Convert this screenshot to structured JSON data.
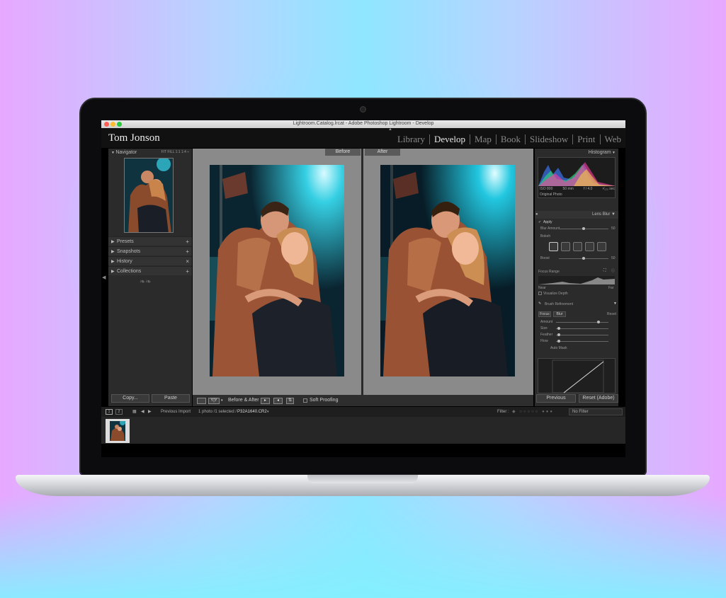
{
  "window": {
    "title": "Lightroom.Catalog.lrcat - Adobe Photoshop Lightroom - Develop"
  },
  "identity_plate": "Tom Jonson",
  "modules": [
    "Library",
    "Develop",
    "Map",
    "Book",
    "Slideshow",
    "Print",
    "Web"
  ],
  "active_module": "Develop",
  "left_panel": {
    "navigator": {
      "label": "Navigator",
      "zoom_options": "FIT  FILL  1:1  1:4 ÷"
    },
    "sections": [
      {
        "label": "Presets",
        "action": "+"
      },
      {
        "label": "Snapshots",
        "action": "+"
      },
      {
        "label": "History",
        "action": "×"
      },
      {
        "label": "Collections",
        "action": "+"
      }
    ],
    "copy_button": "Copy...",
    "paste_button": "Paste"
  },
  "center": {
    "before_label": "Before",
    "after_label": "After"
  },
  "toolbar": {
    "yy_label": "Y|Y",
    "before_after_label": "Before & After :",
    "soft_proofing": "Soft Proofing"
  },
  "right_panel": {
    "histogram_label": "Histogram",
    "stats": {
      "iso": "ISO 800",
      "focal": "50 mm",
      "aperture": "f / 4.0",
      "shutter": "¹⁄₁₂₀ sec"
    },
    "original_photo": "Original Photo",
    "lens_blur_label": "Lens Blur",
    "apply_label": "Apply",
    "blur_amount_label": "Blur Amount",
    "blur_amount_value": "50",
    "bokeh_label": "Bokeh",
    "boost_label": "Boost",
    "boost_value": "50",
    "focus_range_label": "Focus Range",
    "near_label": "Near",
    "far_label": "Far",
    "visualize_depth": "Visualize Depth",
    "brush_refinement": "Brush Refinement",
    "focus_tab": "Focus",
    "blur_tab": "Blur",
    "reset_label": "Reset",
    "amount_labels": [
      "Amount",
      "Size",
      "Feather",
      "Flow"
    ],
    "auto_mask": "Auto Mask",
    "previous_button": "Previous",
    "reset_adobe_button": "Reset (Adobe)"
  },
  "filmstrip": {
    "source": "Previous Import",
    "selection_prefix": "1 photo /1 selected /",
    "filename": "P32A1640.CR2",
    "filter_label": "Filter :",
    "filter_value": "No Filter"
  },
  "colors": {
    "accent_teal": "#12b7c9",
    "panel_bg": "#2b2b2b",
    "app_bg": "#000000"
  }
}
